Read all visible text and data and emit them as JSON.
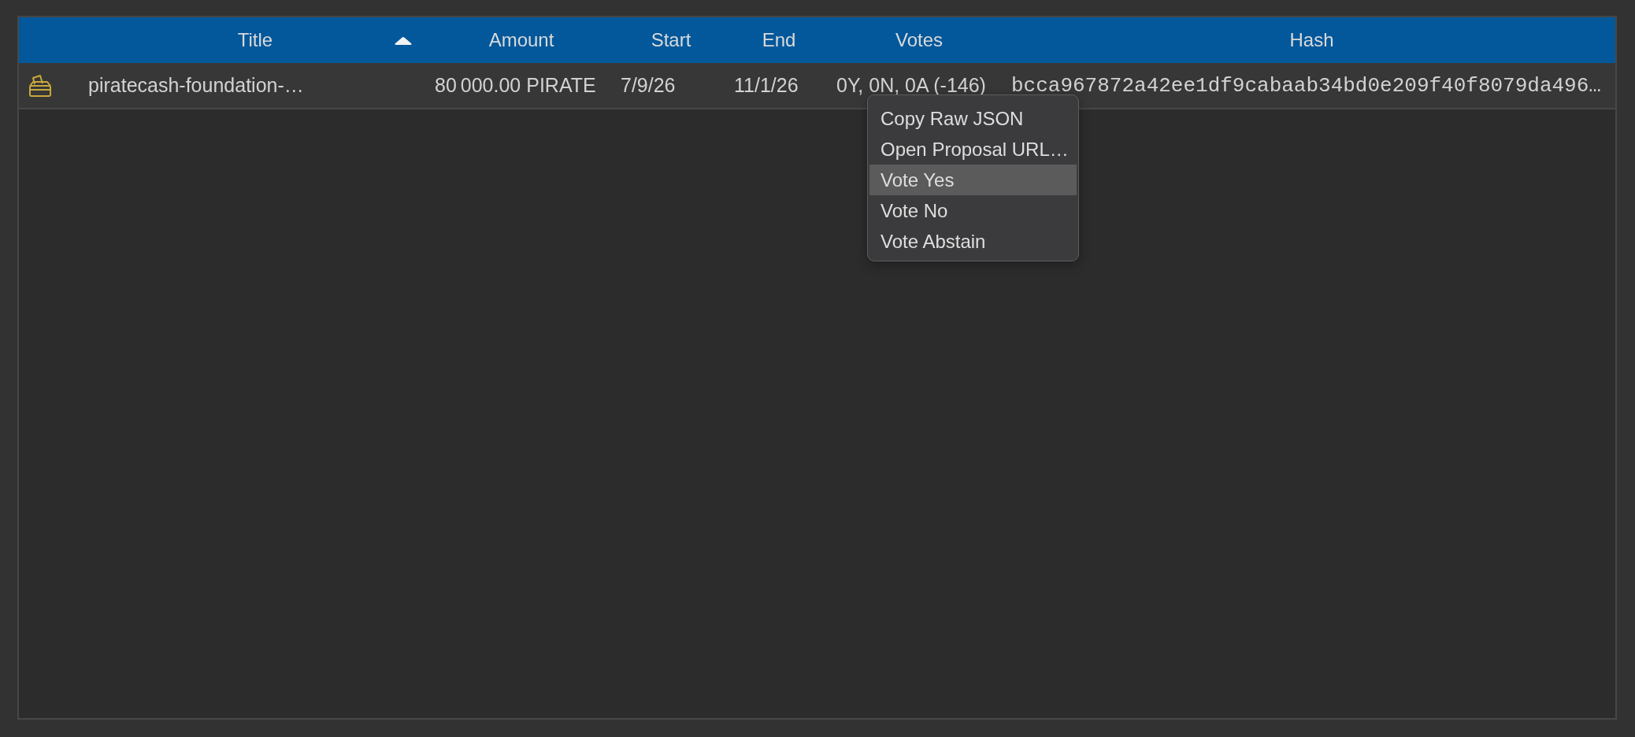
{
  "table": {
    "columns": [
      {
        "label": "Title",
        "sorted": true
      },
      {
        "label": "Amount",
        "sorted": false
      },
      {
        "label": "Start",
        "sorted": false
      },
      {
        "label": "End",
        "sorted": false
      },
      {
        "label": "Votes",
        "sorted": false
      },
      {
        "label": "Hash",
        "sorted": false
      }
    ],
    "rows": [
      {
        "cells": [
          "piratecash-foundation-…",
          "80 000.00 PIRATE",
          "7/9/26",
          "11/1/26",
          "0Y, 0N, 0A (-146)",
          "bcca967872a42ee1df9cabaab34bd0e209f40f8079da496…"
        ]
      }
    ]
  },
  "context_menu": {
    "items": [
      {
        "label": "Copy Raw JSON",
        "selected": false
      },
      {
        "label": "Open Proposal URL…",
        "selected": false
      },
      {
        "label": "Vote Yes",
        "selected": true
      },
      {
        "label": "Vote No",
        "selected": false
      },
      {
        "label": "Vote Abstain",
        "selected": false
      }
    ]
  }
}
